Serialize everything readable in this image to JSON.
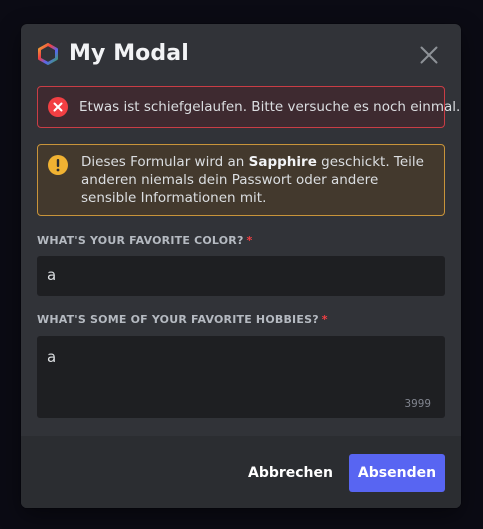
{
  "modal": {
    "title": "My Modal",
    "icons": {
      "app": "hexagon-logo-icon",
      "close": "close-icon"
    }
  },
  "error": {
    "icon": "error-circle-icon",
    "message": "Etwas ist schiefgelaufen. Bitte versuche es noch einmal."
  },
  "warning": {
    "icon": "warning-circle-icon",
    "text_before": "Dieses Formular wird an ",
    "bold": "Sapphire",
    "text_after": " geschickt. Teile anderen niemals dein Passwort oder andere sensible Informationen mit."
  },
  "fields": [
    {
      "label": "What's your favorite color?",
      "required_mark": "*",
      "value": "a"
    },
    {
      "label": "What's some of your favorite hobbies?",
      "required_mark": "*",
      "value": "a",
      "remaining_chars": "3999"
    }
  ],
  "footer": {
    "cancel_label": "Abbrechen",
    "submit_label": "Absenden"
  },
  "colors": {
    "accent": "#5865f2",
    "error": "#f23f43",
    "warning": "#f0b232",
    "background": "#313338"
  }
}
